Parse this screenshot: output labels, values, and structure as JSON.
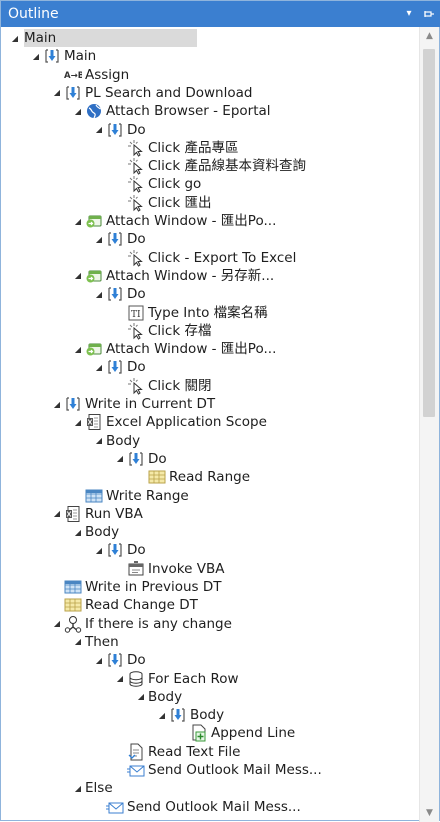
{
  "panel": {
    "title": "Outline"
  },
  "tree": [
    {
      "label": "Main",
      "icon": "none",
      "indent": 0,
      "expanded": true,
      "selected": true
    },
    {
      "label": "Main",
      "icon": "sequence-icon",
      "indent": 1,
      "expanded": true
    },
    {
      "label": "Assign",
      "icon": "assign-icon",
      "indent": 2,
      "expanded": null
    },
    {
      "label": "PL Search and Download",
      "icon": "sequence-icon",
      "indent": 2,
      "expanded": true
    },
    {
      "label": "Attach Browser - Eportal",
      "icon": "browser-globe-icon",
      "indent": 3,
      "expanded": true
    },
    {
      "label": "Do",
      "icon": "sequence-icon",
      "indent": 4,
      "expanded": true
    },
    {
      "label": "Click 產品專區",
      "icon": "click-icon",
      "indent": 5,
      "expanded": null
    },
    {
      "label": "Click 產品線基本資料查詢",
      "icon": "click-icon",
      "indent": 5,
      "expanded": null
    },
    {
      "label": "Click go",
      "icon": "click-icon",
      "indent": 5,
      "expanded": null
    },
    {
      "label": "Click 匯出",
      "icon": "click-icon",
      "indent": 5,
      "expanded": null
    },
    {
      "label": "Attach Window - 匯出Po...",
      "icon": "attach-window-icon",
      "indent": 3,
      "expanded": true
    },
    {
      "label": "Do",
      "icon": "sequence-icon",
      "indent": 4,
      "expanded": true
    },
    {
      "label": "Click - Export To Excel",
      "icon": "click-icon",
      "indent": 5,
      "expanded": null
    },
    {
      "label": "Attach Window - 另存新...",
      "icon": "attach-window-icon",
      "indent": 3,
      "expanded": true
    },
    {
      "label": "Do",
      "icon": "sequence-icon",
      "indent": 4,
      "expanded": true
    },
    {
      "label": "Type Into 檔案名稱",
      "icon": "type-into-icon",
      "indent": 5,
      "expanded": null
    },
    {
      "label": "Click 存檔",
      "icon": "click-icon",
      "indent": 5,
      "expanded": null
    },
    {
      "label": "Attach Window - 匯出Po...",
      "icon": "attach-window-icon",
      "indent": 3,
      "expanded": true
    },
    {
      "label": "Do",
      "icon": "sequence-icon",
      "indent": 4,
      "expanded": true
    },
    {
      "label": "Click 關閉",
      "icon": "click-icon",
      "indent": 5,
      "expanded": null
    },
    {
      "label": "Write in Current DT",
      "icon": "sequence-icon",
      "indent": 2,
      "expanded": true
    },
    {
      "label": "Excel Application Scope",
      "icon": "excel-scope-icon",
      "indent": 3,
      "expanded": true
    },
    {
      "label": "Body",
      "icon": "none",
      "indent": 4,
      "expanded": true
    },
    {
      "label": "Do",
      "icon": "sequence-icon",
      "indent": 5,
      "expanded": true
    },
    {
      "label": "Read Range",
      "icon": "read-range-icon",
      "indent": 6,
      "expanded": null
    },
    {
      "label": "Write Range",
      "icon": "write-range-icon",
      "indent": 3,
      "expanded": null
    },
    {
      "label": "Run VBA",
      "icon": "excel-scope-icon",
      "indent": 2,
      "expanded": true
    },
    {
      "label": "Body",
      "icon": "none",
      "indent": 3,
      "expanded": true
    },
    {
      "label": "Do",
      "icon": "sequence-icon",
      "indent": 4,
      "expanded": true
    },
    {
      "label": "Invoke VBA",
      "icon": "invoke-vba-icon",
      "indent": 5,
      "expanded": null
    },
    {
      "label": "Write in Previous DT",
      "icon": "write-range-icon",
      "indent": 2,
      "expanded": null
    },
    {
      "label": "Read Change DT",
      "icon": "read-range-icon",
      "indent": 2,
      "expanded": null
    },
    {
      "label": "If there is any change",
      "icon": "if-icon",
      "indent": 2,
      "expanded": true
    },
    {
      "label": "Then",
      "icon": "none",
      "indent": 3,
      "expanded": true
    },
    {
      "label": "Do",
      "icon": "sequence-icon",
      "indent": 4,
      "expanded": true
    },
    {
      "label": "For Each Row",
      "icon": "for-each-row-icon",
      "indent": 5,
      "expanded": true
    },
    {
      "label": "Body",
      "icon": "none",
      "indent": 6,
      "expanded": true
    },
    {
      "label": "Body",
      "icon": "sequence-icon",
      "indent": 7,
      "expanded": true
    },
    {
      "label": "Append Line",
      "icon": "append-line-icon",
      "indent": 8,
      "expanded": null
    },
    {
      "label": "Read Text File",
      "icon": "read-text-file-icon",
      "indent": 5,
      "expanded": null
    },
    {
      "label": "Send Outlook Mail Mess...",
      "icon": "outlook-mail-icon",
      "indent": 5,
      "expanded": null
    },
    {
      "label": "Else",
      "icon": "none",
      "indent": 3,
      "expanded": true
    },
    {
      "label": "Send Outlook Mail Mess...",
      "icon": "outlook-mail-icon",
      "indent": 4,
      "expanded": null
    }
  ]
}
